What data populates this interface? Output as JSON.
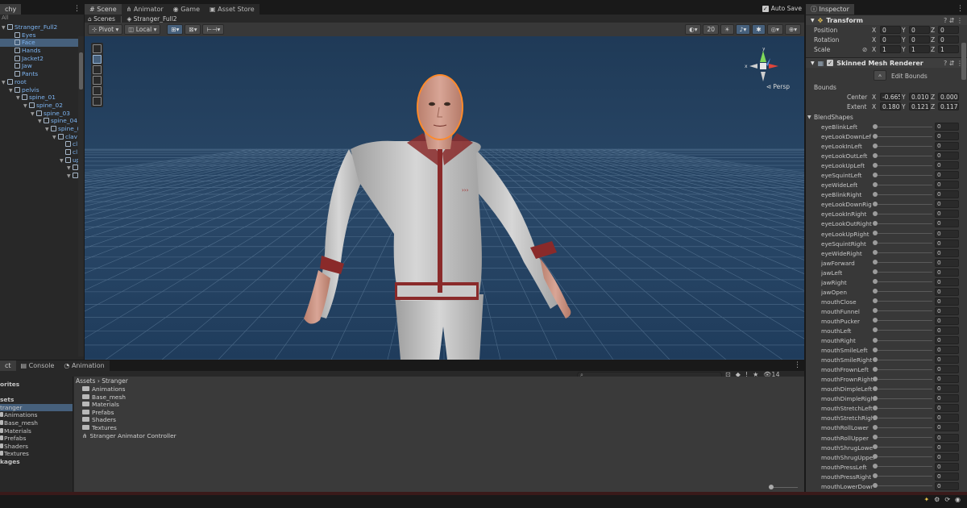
{
  "hierarchy": {
    "tab_label": "chy",
    "search_placeholder": "All",
    "items": [
      {
        "label": "Stranger_Full2",
        "depth": 0,
        "arrow": "▼",
        "selected": false
      },
      {
        "label": "Eyes",
        "depth": 1,
        "arrow": "",
        "selected": false
      },
      {
        "label": "Face",
        "depth": 1,
        "arrow": "",
        "selected": true
      },
      {
        "label": "Hands",
        "depth": 1,
        "arrow": "",
        "selected": false
      },
      {
        "label": "Jacket2",
        "depth": 1,
        "arrow": "",
        "selected": false
      },
      {
        "label": "Jaw",
        "depth": 1,
        "arrow": "",
        "selected": false
      },
      {
        "label": "Pants",
        "depth": 1,
        "arrow": "",
        "selected": false
      },
      {
        "label": "root",
        "depth": 0,
        "arrow": "▼",
        "selected": false
      },
      {
        "label": "pelvis",
        "depth": 1,
        "arrow": "▼",
        "selected": false
      },
      {
        "label": "spine_01",
        "depth": 2,
        "arrow": "▼",
        "selected": false
      },
      {
        "label": "spine_02",
        "depth": 3,
        "arrow": "▼",
        "selected": false
      },
      {
        "label": "spine_03",
        "depth": 4,
        "arrow": "▼",
        "selected": false
      },
      {
        "label": "spine_04",
        "depth": 5,
        "arrow": "▼",
        "selected": false
      },
      {
        "label": "spine_(",
        "depth": 6,
        "arrow": "▼",
        "selected": false
      },
      {
        "label": "clav",
        "depth": 7,
        "arrow": "▼",
        "selected": false
      },
      {
        "label": "cl",
        "depth": 8,
        "arrow": "",
        "selected": false
      },
      {
        "label": "cl",
        "depth": 8,
        "arrow": "",
        "selected": false
      },
      {
        "label": "up",
        "depth": 8,
        "arrow": "▼",
        "selected": false
      },
      {
        "label": "",
        "depth": 9,
        "arrow": "▼",
        "selected": false
      },
      {
        "label": "",
        "depth": 9,
        "arrow": "▼",
        "selected": false
      }
    ]
  },
  "scene": {
    "tabs": [
      {
        "label": "Scene",
        "icon": "scene-icon"
      },
      {
        "label": "Animator",
        "icon": "animator-icon"
      },
      {
        "label": "Game",
        "icon": "game-icon"
      },
      {
        "label": "Asset Store",
        "icon": "store-icon"
      }
    ],
    "auto_save": "Auto Save",
    "breadcrumb": {
      "root": "Scenes",
      "current": "Stranger_Full2"
    },
    "toolbar": {
      "pivot": "Pivot",
      "local": "Local",
      "zoom_value": "20",
      "persp": "Persp"
    }
  },
  "inspector": {
    "tab_label": "Inspector",
    "transform": {
      "title": "Transform",
      "rows": [
        {
          "label": "Position",
          "x": "0",
          "y": "0",
          "z": "0"
        },
        {
          "label": "Rotation",
          "x": "0",
          "y": "0",
          "z": "0"
        },
        {
          "label": "Scale",
          "x": "1",
          "y": "1",
          "z": "1"
        }
      ]
    },
    "smr": {
      "title": "Skinned Mesh Renderer",
      "edit_bounds": "Edit Bounds",
      "bounds_label": "Bounds",
      "center": {
        "label": "Center",
        "x": "-0.665",
        "y": "0.010",
        "z": "0.000"
      },
      "extent": {
        "label": "Extent",
        "x": "0.1806",
        "y": "0.1216",
        "z": "0.1172"
      }
    },
    "blendshapes_label": "BlendShapes",
    "blendshapes": [
      {
        "name": "eyeBlinkLeft",
        "value": "0"
      },
      {
        "name": "eyeLookDownLef",
        "value": "0"
      },
      {
        "name": "eyeLookInLeft",
        "value": "0"
      },
      {
        "name": "eyeLookOutLeft",
        "value": "0"
      },
      {
        "name": "eyeLookUpLeft",
        "value": "0"
      },
      {
        "name": "eyeSquintLeft",
        "value": "0"
      },
      {
        "name": "eyeWideLeft",
        "value": "0"
      },
      {
        "name": "eyeBlinkRight",
        "value": "0"
      },
      {
        "name": "eyeLookDownRig",
        "value": "0"
      },
      {
        "name": "eyeLookInRight",
        "value": "0"
      },
      {
        "name": "eyeLookOutRight",
        "value": "0"
      },
      {
        "name": "eyeLookUpRight",
        "value": "0"
      },
      {
        "name": "eyeSquintRight",
        "value": "0"
      },
      {
        "name": "eyeWideRight",
        "value": "0"
      },
      {
        "name": "jawForward",
        "value": "0"
      },
      {
        "name": "jawLeft",
        "value": "0"
      },
      {
        "name": "jawRight",
        "value": "0"
      },
      {
        "name": "jawOpen",
        "value": "0"
      },
      {
        "name": "mouthClose",
        "value": "0"
      },
      {
        "name": "mouthFunnel",
        "value": "0"
      },
      {
        "name": "mouthPucker",
        "value": "0"
      },
      {
        "name": "mouthLeft",
        "value": "0"
      },
      {
        "name": "mouthRight",
        "value": "0"
      },
      {
        "name": "mouthSmileLeft",
        "value": "0"
      },
      {
        "name": "mouthSmileRight",
        "value": "0"
      },
      {
        "name": "mouthFrownLeft",
        "value": "0"
      },
      {
        "name": "mouthFrownRight",
        "value": "0"
      },
      {
        "name": "mouthDimpleLeft",
        "value": "0"
      },
      {
        "name": "mouthDimpleRigh",
        "value": "0"
      },
      {
        "name": "mouthStretchLeft",
        "value": "0"
      },
      {
        "name": "mouthStretchRigh",
        "value": "0"
      },
      {
        "name": "mouthRollLower",
        "value": "0"
      },
      {
        "name": "mouthRollUpper",
        "value": "0"
      },
      {
        "name": "mouthShrugLowe",
        "value": "0"
      },
      {
        "name": "mouthShrugUpper",
        "value": "0"
      },
      {
        "name": "mouthPressLeft",
        "value": "0"
      },
      {
        "name": "mouthPressRight",
        "value": "0"
      },
      {
        "name": "mouthLowerDowr",
        "value": "0"
      }
    ]
  },
  "project": {
    "tabs": [
      {
        "label": "ct"
      },
      {
        "label": "Console"
      },
      {
        "label": "Animation"
      }
    ],
    "count": "14",
    "left_items": [
      {
        "label": "orites",
        "icon": "",
        "bold": true,
        "selected": false
      },
      {
        "label": "",
        "icon": "",
        "bold": false,
        "selected": false
      },
      {
        "label": "sets",
        "icon": "",
        "bold": true,
        "selected": false
      },
      {
        "label": "tranger",
        "icon": "",
        "bold": false,
        "selected": true
      },
      {
        "label": "Animations",
        "icon": "folder",
        "bold": false,
        "selected": false
      },
      {
        "label": "Base_mesh",
        "icon": "folder",
        "bold": false,
        "selected": false
      },
      {
        "label": "Materials",
        "icon": "folder",
        "bold": false,
        "selected": false
      },
      {
        "label": "Prefabs",
        "icon": "folder",
        "bold": false,
        "selected": false
      },
      {
        "label": "Shaders",
        "icon": "folder",
        "bold": false,
        "selected": false
      },
      {
        "label": "Textures",
        "icon": "folder",
        "bold": false,
        "selected": false
      },
      {
        "label": "kages",
        "icon": "",
        "bold": true,
        "selected": false
      }
    ],
    "path": {
      "root": "Assets",
      "current": "Stranger"
    },
    "items": [
      {
        "label": "Animations",
        "icon": "folder"
      },
      {
        "label": "Base_mesh",
        "icon": "folder"
      },
      {
        "label": "Materials",
        "icon": "folder"
      },
      {
        "label": "Prefabs",
        "icon": "folder"
      },
      {
        "label": "Shaders",
        "icon": "folder"
      },
      {
        "label": "Textures",
        "icon": "folder"
      },
      {
        "label": "Stranger Animator Controller",
        "icon": "animator-controller"
      }
    ]
  },
  "colors": {
    "selection": "#46607c",
    "link_blue": "#7cb3f0",
    "sky": "#223c57",
    "jacket": "#c8c8c8",
    "trim_red": "#8a2a2a",
    "outline_orange": "#ff8a2a"
  }
}
